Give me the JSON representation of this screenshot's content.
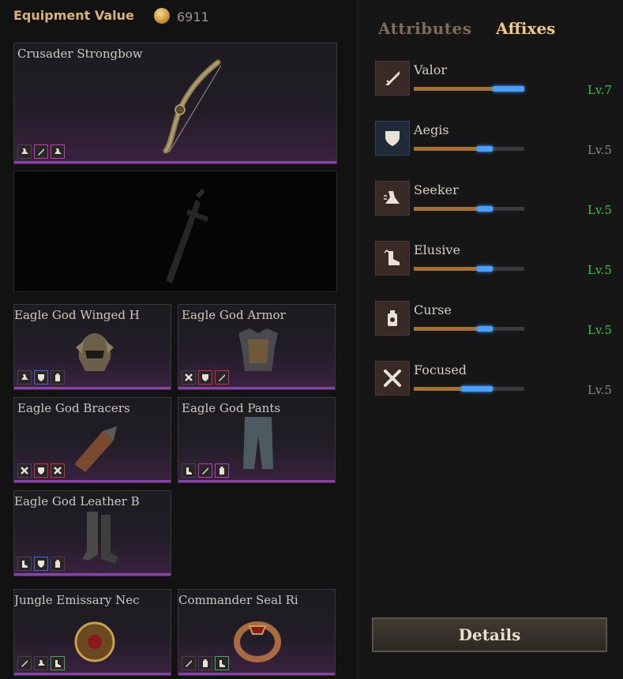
{
  "header": {
    "equipment_value_label": "Equipment Value",
    "equipment_value": "6911",
    "currency_icon": "gold-coin-icon"
  },
  "equipment": {
    "weapon_main": {
      "name": "Crusader Strongbow",
      "slots": [
        "seeker-icon",
        "valor-icon",
        "seeker-icon"
      ]
    },
    "weapon_off": {
      "name": ""
    },
    "head": {
      "name": "Eagle God Winged H",
      "slots": [
        "seeker-icon",
        "aegis-icon",
        "curse-icon"
      ]
    },
    "chest": {
      "name": "Eagle God Armor",
      "slots": [
        "focused-icon",
        "aegis-icon",
        "valor-icon"
      ]
    },
    "bracers": {
      "name": "Eagle God Bracers",
      "slots": [
        "focused-icon",
        "aegis-icon",
        "focused-icon"
      ]
    },
    "pants": {
      "name": "Eagle God Pants",
      "slots": [
        "elusive-icon",
        "valor-icon",
        "curse-icon"
      ]
    },
    "boots": {
      "name": "Eagle God Leather B",
      "slots": [
        "elusive-icon",
        "aegis-icon",
        "curse-icon"
      ]
    },
    "necklace": {
      "name": "Jungle Emissary Nec",
      "slots": [
        "valor-icon",
        "seeker-icon",
        "elusive-icon"
      ]
    },
    "ring": {
      "name": "Commander Seal Ri",
      "slots": [
        "valor-icon",
        "curse-icon",
        "elusive-icon"
      ]
    }
  },
  "tabs": {
    "attributes": "Attributes",
    "affixes": "Affixes",
    "active": "Affixes"
  },
  "affixes": [
    {
      "name": "Valor",
      "level": "Lv.7",
      "level_color": "#3fbf3f",
      "icon": "sword-icon",
      "progress": 1.0
    },
    {
      "name": "Aegis",
      "level": "Lv.5",
      "level_color": "#8a8680",
      "icon": "shield-icon",
      "progress": 0.71
    },
    {
      "name": "Seeker",
      "level": "Lv.5",
      "level_color": "#3fbf3f",
      "icon": "running-boot-icon",
      "progress": 0.71
    },
    {
      "name": "Elusive",
      "level": "Lv.5",
      "level_color": "#3fbf3f",
      "icon": "dodge-foot-icon",
      "progress": 0.71
    },
    {
      "name": "Curse",
      "level": "Lv.5",
      "level_color": "#3fbf3f",
      "icon": "skull-potion-icon",
      "progress": 0.71
    },
    {
      "name": "Focused",
      "level": "Lv.5",
      "level_color": "#8a8680",
      "icon": "crossed-bones-icon",
      "progress": 0.71
    }
  ],
  "details_button": "Details",
  "colors": {
    "accent_gold": "#d9b27a",
    "rarity_purple": "#8d3fb0",
    "progress_blue": "#4aa0ff"
  }
}
